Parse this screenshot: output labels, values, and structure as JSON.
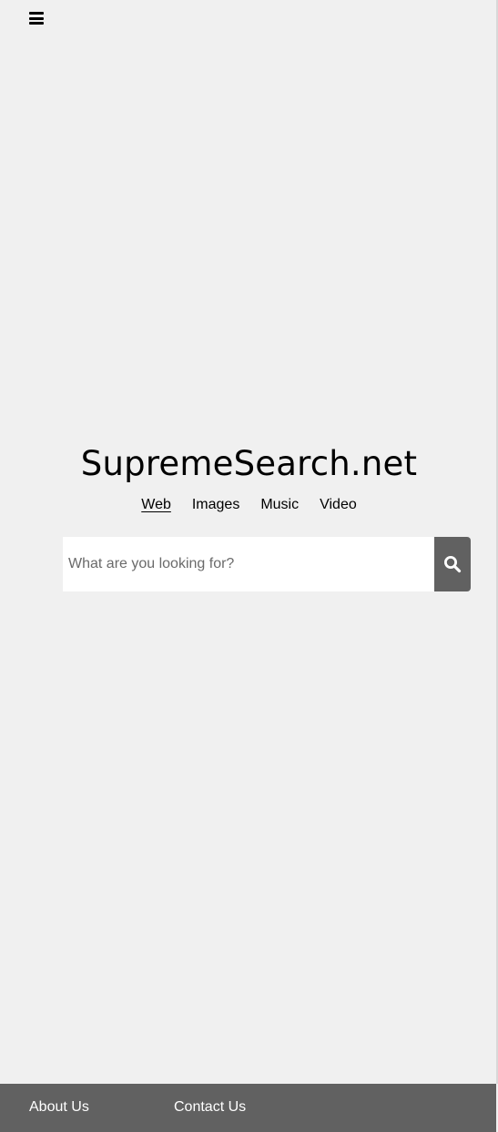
{
  "header": {
    "menu_icon": "hamburger-menu-icon"
  },
  "logo": {
    "text": "SupremeSearch.net"
  },
  "tabs": [
    {
      "label": "Web",
      "active": true
    },
    {
      "label": "Images",
      "active": false
    },
    {
      "label": "Music",
      "active": false
    },
    {
      "label": "Video",
      "active": false
    }
  ],
  "search": {
    "placeholder": "What are you looking for?",
    "value": "",
    "button_icon": "search-icon"
  },
  "footer": {
    "links": [
      {
        "label": "About Us"
      },
      {
        "label": "Contact Us"
      }
    ]
  },
  "colors": {
    "background": "#f0f0f0",
    "footer": "#616161",
    "search_button": "#616161",
    "input_background": "#ffffff"
  }
}
